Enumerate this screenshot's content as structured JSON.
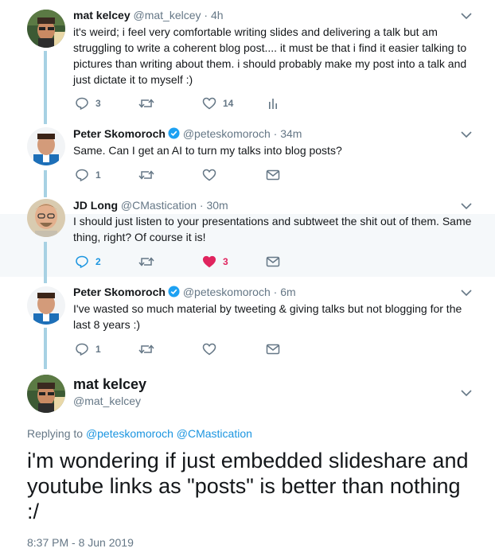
{
  "colors": {
    "link": "#1b95e0",
    "muted": "#657786",
    "like": "#e0245e",
    "thread": "#a7d1e3"
  },
  "tweets": [
    {
      "name": "mat kelcey",
      "handle": "@mat_kelcey",
      "time": "· 4h",
      "verified": false,
      "text": "it's weird; i feel very comfortable writing slides and delivering a talk but am struggling to write a coherent blog post.... it must be that i find it easier talking to pictures than writing about them. i should probably make my post into a talk and just dictate it to myself :)",
      "replies": "3",
      "retweets": "",
      "likes": "14",
      "last_icon": "analytics-icon"
    },
    {
      "name": "Peter Skomoroch",
      "handle": "@peteskomoroch",
      "time": "· 34m",
      "verified": true,
      "text": "Same. Can I get an AI to turn my talks into blog posts?",
      "replies": "1",
      "retweets": "",
      "likes": "",
      "last_icon": "envelope-icon"
    },
    {
      "name": "JD Long",
      "handle": "@CMastication",
      "time": "· 30m",
      "verified": false,
      "text": "I should just listen to your presentations and subtweet the shit out of them. Same thing, right? Of course it is!",
      "replies": "2",
      "retweets": "",
      "likes": "3",
      "last_icon": "envelope-icon"
    },
    {
      "name": "Peter Skomoroch",
      "handle": "@peteskomoroch",
      "time": "· 6m",
      "verified": true,
      "text": "I've wasted so much material by tweeting & giving talks but not blogging for the last 8 years :)",
      "replies": "1",
      "retweets": "",
      "likes": "",
      "last_icon": "envelope-icon"
    }
  ],
  "main": {
    "name": "mat kelcey",
    "handle": "@mat_kelcey",
    "replying_prefix": "Replying to",
    "replying_to": [
      "@peteskomoroch",
      "@CMastication"
    ],
    "text": "i'm wondering if just embedded slideshare and youtube links as \"posts\" is better than nothing :/",
    "timestamp": "8:37 PM - 8 Jun 2019"
  }
}
